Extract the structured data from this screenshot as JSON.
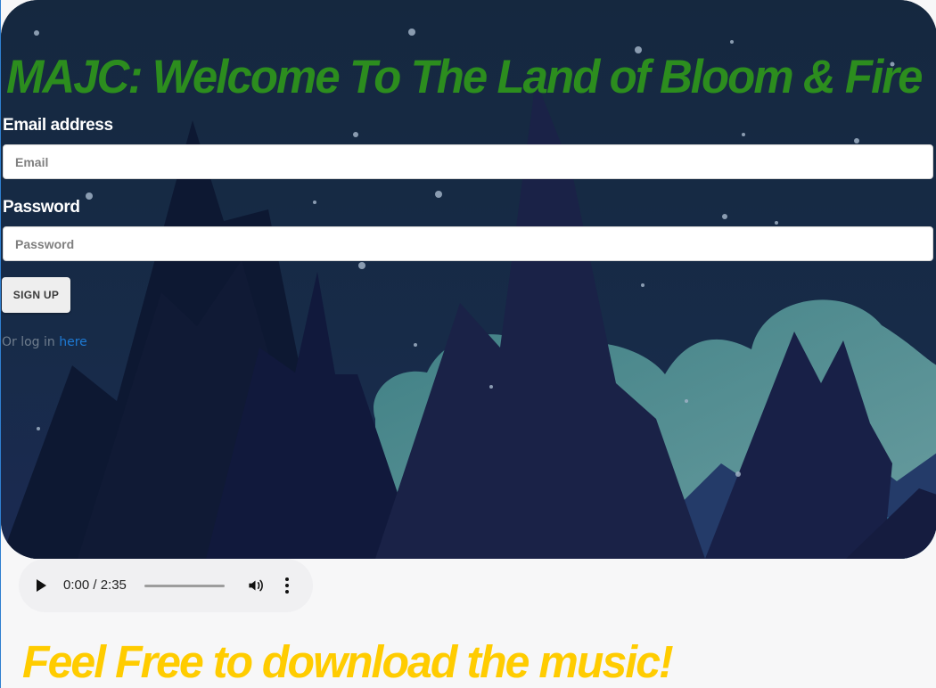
{
  "header": {
    "title": "MAJC: Welcome To The Land of Bloom & Fire"
  },
  "form": {
    "email_label": "Email address",
    "email_placeholder": "Email",
    "password_label": "Password",
    "password_placeholder": "Password",
    "signup_label": "SIGN UP",
    "login_prefix": "Or log in ",
    "login_link": "here"
  },
  "audio": {
    "time": "0:00 / 2:35",
    "progress": 0
  },
  "footer": {
    "text": "Feel Free to download the music!"
  },
  "colors": {
    "title": "#2c8d1e",
    "footer": "#ffcc00",
    "link": "#1d7ad4"
  },
  "icons": [
    "play-icon",
    "volume-icon",
    "more-options-icon"
  ]
}
